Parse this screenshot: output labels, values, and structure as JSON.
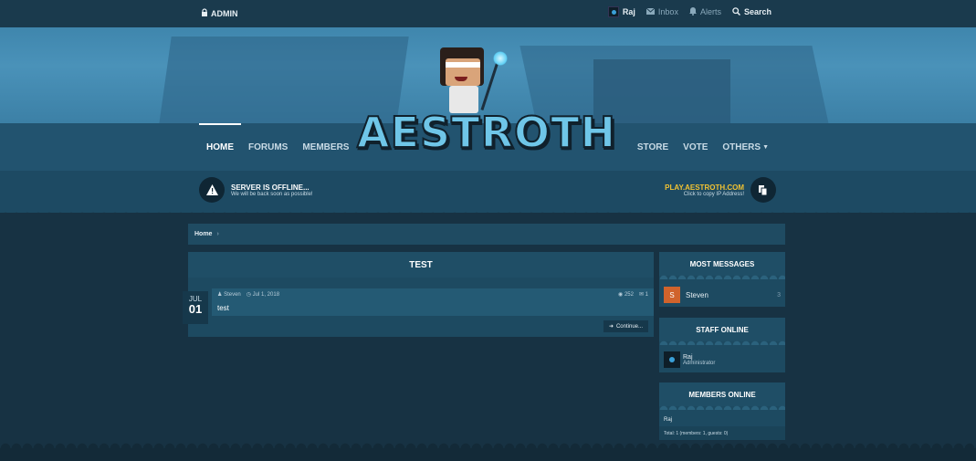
{
  "topbar": {
    "admin_label": "ADMIN",
    "user_name": "Raj",
    "inbox_label": "Inbox",
    "alerts_label": "Alerts",
    "search_label": "Search"
  },
  "nav": {
    "left": [
      "HOME",
      "FORUMS",
      "MEMBERS"
    ],
    "right": [
      "STORE",
      "VOTE",
      "OTHERS"
    ]
  },
  "logo": {
    "wordmark": "AESTROTH"
  },
  "server": {
    "status_title": "SERVER IS OFFLINE...",
    "status_sub": "We will be back soon as possible!",
    "ip_title": "PLAY.AESTROTH.COM",
    "ip_sub": "Click to copy IP Address!"
  },
  "breadcrumb": {
    "home": "Home"
  },
  "main": {
    "title": "TEST",
    "date_month": "JUL",
    "date_day": "01",
    "author": "Steven",
    "date": "Jul 1, 2018",
    "views": "252",
    "replies": "1",
    "body": "test",
    "continue_label": "Continue..."
  },
  "sidebar": {
    "most_messages": {
      "title": "MOST MESSAGES",
      "avatar_letter": "S",
      "name": "Steven",
      "count": "3"
    },
    "staff_online": {
      "title": "STAFF ONLINE",
      "name": "Raj",
      "role": "Administrator"
    },
    "members_online": {
      "title": "MEMBERS ONLINE",
      "name": "Raj",
      "total": "Total: 1 (members: 1, guests: 0)"
    }
  },
  "colors": {
    "background": "#173243",
    "nav": "#22536f",
    "accent_ip": "#f1c232",
    "avatar_s": "#d0632c"
  }
}
